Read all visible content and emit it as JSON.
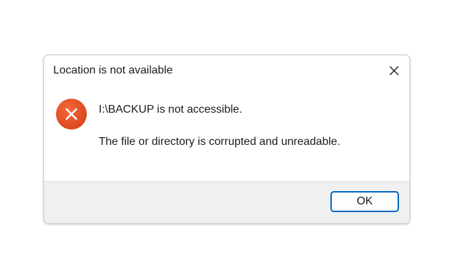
{
  "dialog": {
    "title": "Location is not available",
    "close_icon": "close-icon",
    "icon": "error-icon",
    "icon_color": "#e8501e",
    "message_primary": "I:\\BACKUP is not accessible.",
    "message_secondary": "The file or directory is corrupted and unreadable.",
    "ok_label": "OK",
    "accent_color": "#0067c0"
  }
}
